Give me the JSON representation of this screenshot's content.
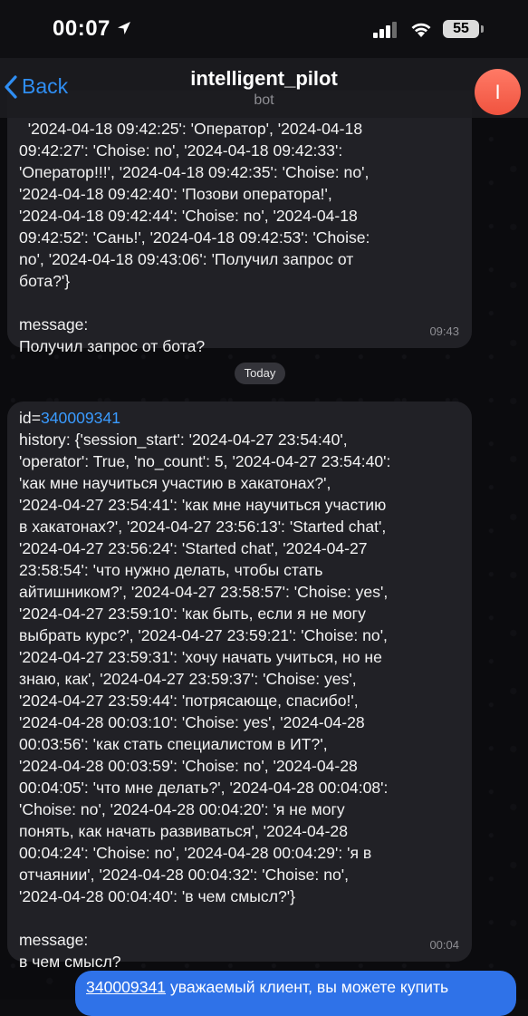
{
  "status": {
    "time": "00:07",
    "battery": "55"
  },
  "header": {
    "back_label": "Back",
    "title": "intelligent_pilot",
    "subtitle": "bot",
    "avatar_letter": "I"
  },
  "messages": [
    {
      "text_lines": "'2024-04-18 09:42:25': 'Оператор', '2024-04-18\n09:42:27': 'Choise: no', '2024-04-18 09:42:33':\n'Оператор!!!', '2024-04-18 09:42:35': 'Choise: no',\n'2024-04-18 09:42:40': 'Позови оператора!',\n'2024-04-18 09:42:44': 'Choise: no', '2024-04-18\n09:42:52': 'Сань!', '2024-04-18 09:42:53': 'Choise:\nno', '2024-04-18 09:43:06': 'Получил запрос от\nбота?'}\n\nmessage:\nПолучил запрос от бота?",
      "time": "09:43"
    },
    {
      "id_prefix": "id=",
      "id_link": "340009341",
      "text_lines": "history: {'session_start': '2024-04-27 23:54:40',\n'operator': True, 'no_count': 5, '2024-04-27 23:54:40':\n'как мне научиться участию в хакатонах?',\n'2024-04-27 23:54:41': 'как мне научиться участию\nв хакатонах?', '2024-04-27 23:56:13': 'Started chat',\n'2024-04-27 23:56:24': 'Started chat', '2024-04-27\n23:58:54': 'что нужно делать, чтобы стать\nайтишником?', '2024-04-27 23:58:57': 'Choise: yes',\n'2024-04-27 23:59:10': 'как быть, если я не могу\nвыбрать курс?', '2024-04-27 23:59:21': 'Choise: no',\n'2024-04-27 23:59:31': 'хочу начать учиться, но не\nзнаю, как', '2024-04-27 23:59:37': 'Choise: yes',\n'2024-04-27 23:59:44': 'потрясающе, спасибо!',\n'2024-04-28 00:03:10': 'Choise: yes', '2024-04-28\n00:03:56': 'как стать специалистом в ИТ?',\n'2024-04-28 00:03:59': 'Choise: no', '2024-04-28\n00:04:05': 'что мне делать?', '2024-04-28 00:04:08':\n'Choise: no', '2024-04-28 00:04:20': 'я не могу\nпонять, как начать развиваться', '2024-04-28\n00:04:24': 'Choise: no', '2024-04-28 00:04:29': 'я в\nотчаянии', '2024-04-28 00:04:32': 'Choise: no',\n'2024-04-28 00:04:40': 'в чем смысл?'}\n\nmessage:\nв чем смысл?",
      "time": "00:04"
    }
  ],
  "date_separator": "Today",
  "outgoing": {
    "link": "340009341",
    "text": " уважаемый клиент, вы можете купить"
  },
  "colors": {
    "accent": "#2f8ef3",
    "outgoing_bubble": "#2f72e8",
    "avatar": "#f0533f"
  }
}
